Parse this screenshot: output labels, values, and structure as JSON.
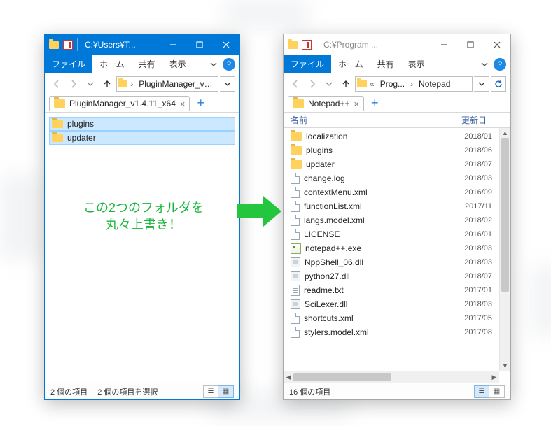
{
  "annotation": {
    "line1": "この2つのフォルダを",
    "line2": "丸々上書き！"
  },
  "ribbon": {
    "file": "ファイル",
    "home": "ホーム",
    "share": "共有",
    "view": "表示",
    "help": "?"
  },
  "left": {
    "titlebar": {
      "title": "C:¥Users¥T..."
    },
    "address": {
      "crumb1": "PluginManager_v1...."
    },
    "tab": {
      "label": "PluginManager_v1.4.11_x64"
    },
    "items": [
      {
        "name": "plugins",
        "type": "folder",
        "selected": true
      },
      {
        "name": "updater",
        "type": "folder",
        "selected": true
      }
    ],
    "status": {
      "count": "2 個の項目",
      "selection": "2 個の項目を選択"
    }
  },
  "right": {
    "titlebar": {
      "title": "C:¥Program ..."
    },
    "address": {
      "prefix": "«",
      "crumb1": "Prog...",
      "crumb2": "Notepad"
    },
    "tab": {
      "label": "Notepad++"
    },
    "columns": {
      "name": "名前",
      "date": "更新日"
    },
    "items": [
      {
        "name": "localization",
        "type": "folder",
        "date": "2018/01"
      },
      {
        "name": "plugins",
        "type": "folder",
        "date": "2018/06"
      },
      {
        "name": "updater",
        "type": "folder",
        "date": "2018/07"
      },
      {
        "name": "change.log",
        "type": "file",
        "date": "2018/03"
      },
      {
        "name": "contextMenu.xml",
        "type": "file",
        "date": "2016/09"
      },
      {
        "name": "functionList.xml",
        "type": "file",
        "date": "2017/11"
      },
      {
        "name": "langs.model.xml",
        "type": "file",
        "date": "2018/02"
      },
      {
        "name": "LICENSE",
        "type": "file",
        "date": "2016/01"
      },
      {
        "name": "notepad++.exe",
        "type": "app",
        "date": "2018/03"
      },
      {
        "name": "NppShell_06.dll",
        "type": "dll",
        "date": "2018/03"
      },
      {
        "name": "python27.dll",
        "type": "dll",
        "date": "2018/07"
      },
      {
        "name": "readme.txt",
        "type": "txt",
        "date": "2017/01"
      },
      {
        "name": "SciLexer.dll",
        "type": "dll",
        "date": "2018/03"
      },
      {
        "name": "shortcuts.xml",
        "type": "file",
        "date": "2017/05"
      },
      {
        "name": "stylers.model.xml",
        "type": "file",
        "date": "2017/08"
      }
    ],
    "status": {
      "count": "16 個の項目"
    }
  }
}
